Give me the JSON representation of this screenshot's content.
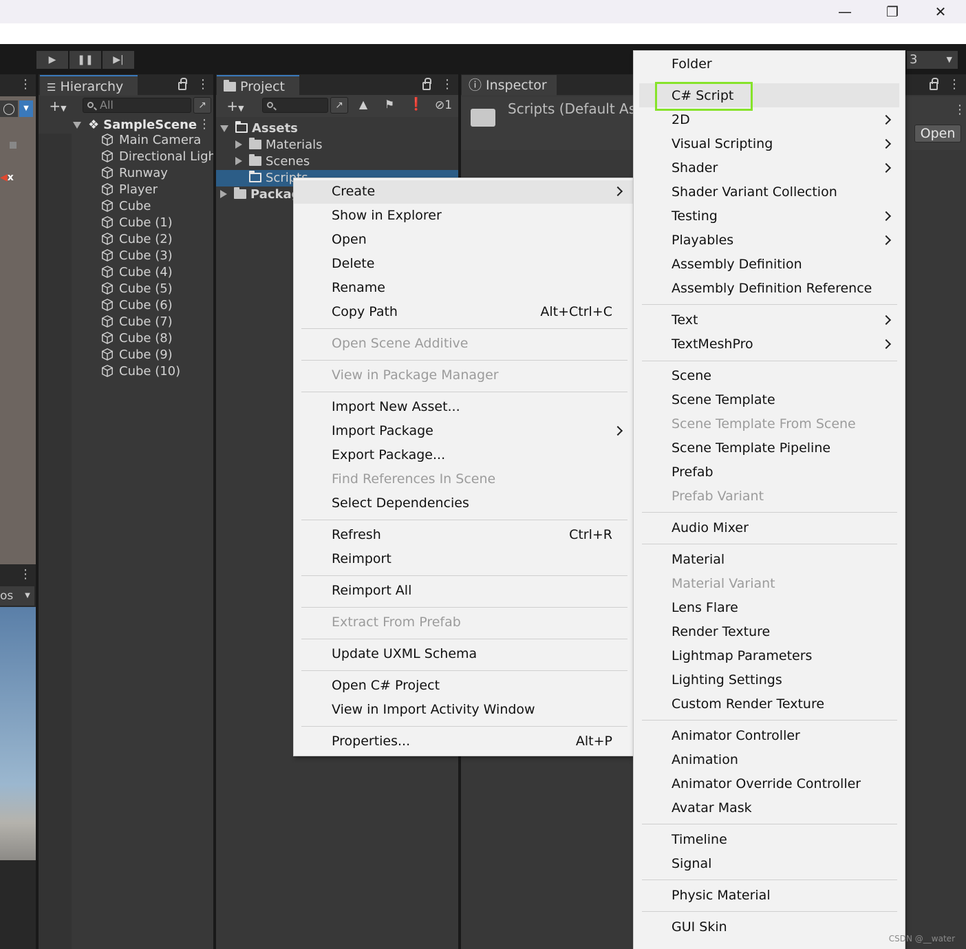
{
  "titlebar": {
    "minimize_icon": "minimize-icon",
    "restore_icon": "restore-icon",
    "close_icon": "close-icon"
  },
  "toolbar": {
    "layer_label": "3"
  },
  "hierarchy": {
    "tab_label": "Hierarchy",
    "search_placeholder": "All",
    "scene_name": "SampleScene",
    "scene_fragment_x": "x",
    "scene_fragment_os": "os",
    "items": [
      "Main Camera",
      "Directional Ligh",
      "Runway",
      "Player",
      "Cube",
      "Cube (1)",
      "Cube (2)",
      "Cube (3)",
      "Cube (4)",
      "Cube (5)",
      "Cube (6)",
      "Cube (7)",
      "Cube (8)",
      "Cube (9)",
      "Cube (10)"
    ]
  },
  "project": {
    "tab_label": "Project",
    "hidden_count": "1",
    "tree": {
      "assets": "Assets",
      "materials": "Materials",
      "scenes": "Scenes",
      "scripts": "Scripts",
      "packages": "Packag"
    }
  },
  "inspector": {
    "tab_label": "Inspector",
    "title": "Scripts (Default As",
    "open_button": "Open"
  },
  "context_menu": {
    "items": [
      {
        "label": "Create",
        "shortcut": "",
        "disabled": false,
        "submenu": true
      },
      {
        "label": "Show in Explorer",
        "shortcut": "",
        "disabled": false
      },
      {
        "label": "Open",
        "shortcut": "",
        "disabled": false
      },
      {
        "label": "Delete",
        "shortcut": "",
        "disabled": false
      },
      {
        "label": "Rename",
        "shortcut": "",
        "disabled": false
      },
      {
        "label": "Copy Path",
        "shortcut": "Alt+Ctrl+C",
        "disabled": false
      },
      {
        "label": "Open Scene Additive",
        "shortcut": "",
        "disabled": true
      },
      {
        "label": "View in Package Manager",
        "shortcut": "",
        "disabled": true
      },
      {
        "label": "Import New Asset...",
        "shortcut": "",
        "disabled": false
      },
      {
        "label": "Import Package",
        "shortcut": "",
        "disabled": false,
        "submenu": true
      },
      {
        "label": "Export Package...",
        "shortcut": "",
        "disabled": false
      },
      {
        "label": "Find References In Scene",
        "shortcut": "",
        "disabled": true
      },
      {
        "label": "Select Dependencies",
        "shortcut": "",
        "disabled": false
      },
      {
        "label": "Refresh",
        "shortcut": "Ctrl+R",
        "disabled": false
      },
      {
        "label": "Reimport",
        "shortcut": "",
        "disabled": false
      },
      {
        "label": "Reimport All",
        "shortcut": "",
        "disabled": false
      },
      {
        "label": "Extract From Prefab",
        "shortcut": "",
        "disabled": true
      },
      {
        "label": "Update UXML Schema",
        "shortcut": "",
        "disabled": false
      },
      {
        "label": "Open C# Project",
        "shortcut": "",
        "disabled": false
      },
      {
        "label": "View in Import Activity Window",
        "shortcut": "",
        "disabled": false
      },
      {
        "label": "Properties...",
        "shortcut": "Alt+P",
        "disabled": false
      }
    ]
  },
  "create_submenu": {
    "items": [
      {
        "label": "Folder",
        "disabled": false
      },
      {
        "label": "C# Script",
        "disabled": false,
        "highlighted": true
      },
      {
        "label": "2D",
        "disabled": false,
        "submenu": true
      },
      {
        "label": "Visual Scripting",
        "disabled": false,
        "submenu": true
      },
      {
        "label": "Shader",
        "disabled": false,
        "submenu": true
      },
      {
        "label": "Shader Variant Collection",
        "disabled": false
      },
      {
        "label": "Testing",
        "disabled": false,
        "submenu": true
      },
      {
        "label": "Playables",
        "disabled": false,
        "submenu": true
      },
      {
        "label": "Assembly Definition",
        "disabled": false
      },
      {
        "label": "Assembly Definition Reference",
        "disabled": false
      },
      {
        "label": "Text",
        "disabled": false,
        "submenu": true
      },
      {
        "label": "TextMeshPro",
        "disabled": false,
        "submenu": true
      },
      {
        "label": "Scene",
        "disabled": false
      },
      {
        "label": "Scene Template",
        "disabled": false
      },
      {
        "label": "Scene Template From Scene",
        "disabled": true
      },
      {
        "label": "Scene Template Pipeline",
        "disabled": false
      },
      {
        "label": "Prefab",
        "disabled": false
      },
      {
        "label": "Prefab Variant",
        "disabled": true
      },
      {
        "label": "Audio Mixer",
        "disabled": false
      },
      {
        "label": "Material",
        "disabled": false
      },
      {
        "label": "Material Variant",
        "disabled": true
      },
      {
        "label": "Lens Flare",
        "disabled": false
      },
      {
        "label": "Render Texture",
        "disabled": false
      },
      {
        "label": "Lightmap Parameters",
        "disabled": false
      },
      {
        "label": "Lighting Settings",
        "disabled": false
      },
      {
        "label": "Custom Render Texture",
        "disabled": false
      },
      {
        "label": "Animator Controller",
        "disabled": false
      },
      {
        "label": "Animation",
        "disabled": false
      },
      {
        "label": "Animator Override Controller",
        "disabled": false
      },
      {
        "label": "Avatar Mask",
        "disabled": false
      },
      {
        "label": "Timeline",
        "disabled": false
      },
      {
        "label": "Signal",
        "disabled": false
      },
      {
        "label": "Physic Material",
        "disabled": false
      },
      {
        "label": "GUI Skin",
        "disabled": false
      }
    ]
  },
  "watermark": "CSDN @__water",
  "colors": {
    "highlight_box": "#86e32a",
    "selection": "#2c5d87",
    "menu_bg": "#f2f2f2"
  }
}
